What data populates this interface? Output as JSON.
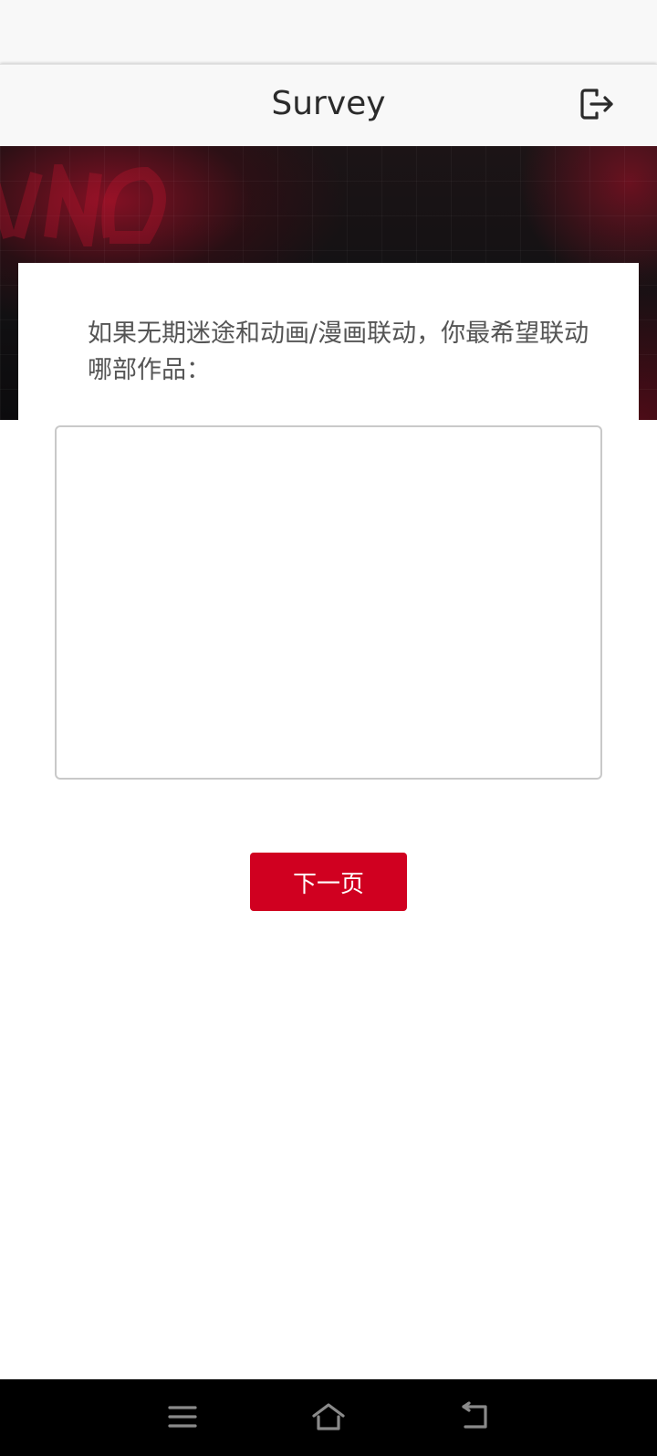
{
  "header": {
    "title": "Survey",
    "logout_icon": "logout-icon"
  },
  "banner": {
    "accent_color": "#c4102d"
  },
  "question": {
    "text": "如果无期迷途和动画/漫画联动，你最希望联动哪部作品："
  },
  "answer": {
    "value": "",
    "placeholder": ""
  },
  "next_button": {
    "label": "下一页",
    "color": "#d00020"
  },
  "nav_bar": {
    "menu_icon": "menu-icon",
    "home_icon": "home-icon",
    "back_icon": "back-icon"
  }
}
